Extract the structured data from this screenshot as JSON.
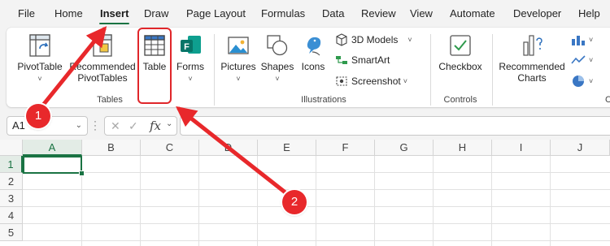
{
  "tabs": [
    "File",
    "Home",
    "Insert",
    "Draw",
    "Page Layout",
    "Formulas",
    "Data",
    "Review",
    "View",
    "Automate",
    "Developer",
    "Help"
  ],
  "active_tab": "Insert",
  "ribbon": {
    "pivottable": "PivotTable",
    "recommended_pivottables_line1": "Recommended",
    "recommended_pivottables_line2": "PivotTables",
    "table": "Table",
    "forms": "Forms",
    "tables_group": "Tables",
    "pictures": "Pictures",
    "shapes": "Shapes",
    "icons": "Icons",
    "models_3d": "3D Models",
    "smartart": "SmartArt",
    "screenshot": "Screenshot",
    "illustrations_group": "Illustrations",
    "checkbox": "Checkbox",
    "controls_group": "Controls",
    "recommended_charts_line1": "Recommended",
    "recommended_charts_line2": "Charts",
    "charts_group_partial": "C",
    "dropdown_glyph": "⌄",
    "chevron_glyph": "˅"
  },
  "formula_bar": {
    "name_box": "A1",
    "fx_label": "fx",
    "cancel_glyph": "✕",
    "enter_glyph": "✓"
  },
  "grid": {
    "columns": [
      "A",
      "B",
      "C",
      "D",
      "E",
      "F",
      "G",
      "H",
      "I",
      "J"
    ],
    "rows": [
      "1",
      "2",
      "3",
      "4",
      "5"
    ],
    "selected_cell": "A1"
  },
  "annotations": {
    "callout_1": "1",
    "callout_2": "2",
    "accent": "#e8282b"
  }
}
